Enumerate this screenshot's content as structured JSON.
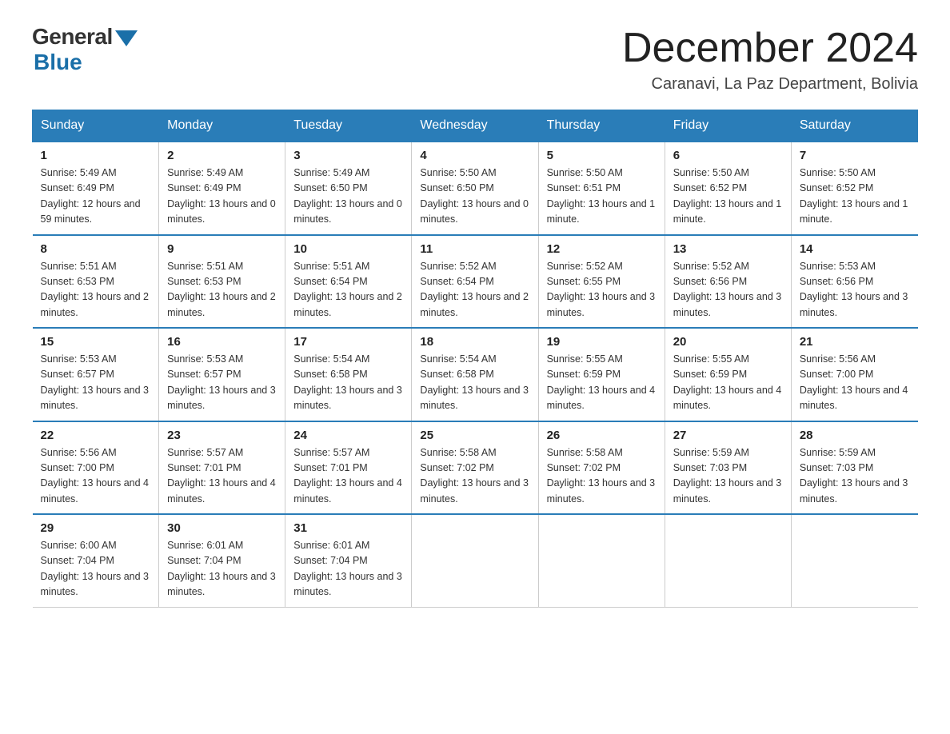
{
  "logo": {
    "general": "General",
    "blue": "Blue"
  },
  "title": "December 2024",
  "subtitle": "Caranavi, La Paz Department, Bolivia",
  "days_of_week": [
    "Sunday",
    "Monday",
    "Tuesday",
    "Wednesday",
    "Thursday",
    "Friday",
    "Saturday"
  ],
  "weeks": [
    [
      {
        "day": "1",
        "sunrise": "5:49 AM",
        "sunset": "6:49 PM",
        "daylight": "12 hours and 59 minutes."
      },
      {
        "day": "2",
        "sunrise": "5:49 AM",
        "sunset": "6:49 PM",
        "daylight": "13 hours and 0 minutes."
      },
      {
        "day": "3",
        "sunrise": "5:49 AM",
        "sunset": "6:50 PM",
        "daylight": "13 hours and 0 minutes."
      },
      {
        "day": "4",
        "sunrise": "5:50 AM",
        "sunset": "6:50 PM",
        "daylight": "13 hours and 0 minutes."
      },
      {
        "day": "5",
        "sunrise": "5:50 AM",
        "sunset": "6:51 PM",
        "daylight": "13 hours and 1 minute."
      },
      {
        "day": "6",
        "sunrise": "5:50 AM",
        "sunset": "6:52 PM",
        "daylight": "13 hours and 1 minute."
      },
      {
        "day": "7",
        "sunrise": "5:50 AM",
        "sunset": "6:52 PM",
        "daylight": "13 hours and 1 minute."
      }
    ],
    [
      {
        "day": "8",
        "sunrise": "5:51 AM",
        "sunset": "6:53 PM",
        "daylight": "13 hours and 2 minutes."
      },
      {
        "day": "9",
        "sunrise": "5:51 AM",
        "sunset": "6:53 PM",
        "daylight": "13 hours and 2 minutes."
      },
      {
        "day": "10",
        "sunrise": "5:51 AM",
        "sunset": "6:54 PM",
        "daylight": "13 hours and 2 minutes."
      },
      {
        "day": "11",
        "sunrise": "5:52 AM",
        "sunset": "6:54 PM",
        "daylight": "13 hours and 2 minutes."
      },
      {
        "day": "12",
        "sunrise": "5:52 AM",
        "sunset": "6:55 PM",
        "daylight": "13 hours and 3 minutes."
      },
      {
        "day": "13",
        "sunrise": "5:52 AM",
        "sunset": "6:56 PM",
        "daylight": "13 hours and 3 minutes."
      },
      {
        "day": "14",
        "sunrise": "5:53 AM",
        "sunset": "6:56 PM",
        "daylight": "13 hours and 3 minutes."
      }
    ],
    [
      {
        "day": "15",
        "sunrise": "5:53 AM",
        "sunset": "6:57 PM",
        "daylight": "13 hours and 3 minutes."
      },
      {
        "day": "16",
        "sunrise": "5:53 AM",
        "sunset": "6:57 PM",
        "daylight": "13 hours and 3 minutes."
      },
      {
        "day": "17",
        "sunrise": "5:54 AM",
        "sunset": "6:58 PM",
        "daylight": "13 hours and 3 minutes."
      },
      {
        "day": "18",
        "sunrise": "5:54 AM",
        "sunset": "6:58 PM",
        "daylight": "13 hours and 3 minutes."
      },
      {
        "day": "19",
        "sunrise": "5:55 AM",
        "sunset": "6:59 PM",
        "daylight": "13 hours and 4 minutes."
      },
      {
        "day": "20",
        "sunrise": "5:55 AM",
        "sunset": "6:59 PM",
        "daylight": "13 hours and 4 minutes."
      },
      {
        "day": "21",
        "sunrise": "5:56 AM",
        "sunset": "7:00 PM",
        "daylight": "13 hours and 4 minutes."
      }
    ],
    [
      {
        "day": "22",
        "sunrise": "5:56 AM",
        "sunset": "7:00 PM",
        "daylight": "13 hours and 4 minutes."
      },
      {
        "day": "23",
        "sunrise": "5:57 AM",
        "sunset": "7:01 PM",
        "daylight": "13 hours and 4 minutes."
      },
      {
        "day": "24",
        "sunrise": "5:57 AM",
        "sunset": "7:01 PM",
        "daylight": "13 hours and 4 minutes."
      },
      {
        "day": "25",
        "sunrise": "5:58 AM",
        "sunset": "7:02 PM",
        "daylight": "13 hours and 3 minutes."
      },
      {
        "day": "26",
        "sunrise": "5:58 AM",
        "sunset": "7:02 PM",
        "daylight": "13 hours and 3 minutes."
      },
      {
        "day": "27",
        "sunrise": "5:59 AM",
        "sunset": "7:03 PM",
        "daylight": "13 hours and 3 minutes."
      },
      {
        "day": "28",
        "sunrise": "5:59 AM",
        "sunset": "7:03 PM",
        "daylight": "13 hours and 3 minutes."
      }
    ],
    [
      {
        "day": "29",
        "sunrise": "6:00 AM",
        "sunset": "7:04 PM",
        "daylight": "13 hours and 3 minutes."
      },
      {
        "day": "30",
        "sunrise": "6:01 AM",
        "sunset": "7:04 PM",
        "daylight": "13 hours and 3 minutes."
      },
      {
        "day": "31",
        "sunrise": "6:01 AM",
        "sunset": "7:04 PM",
        "daylight": "13 hours and 3 minutes."
      },
      null,
      null,
      null,
      null
    ]
  ]
}
